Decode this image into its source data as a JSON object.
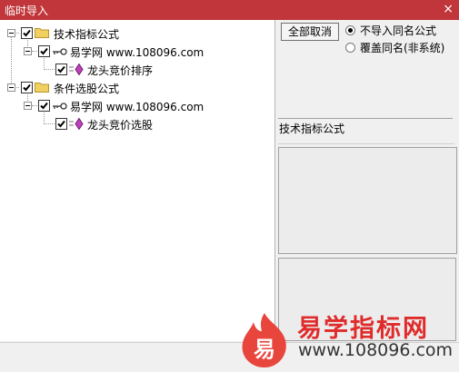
{
  "window": {
    "title": "临时导入",
    "close_glyph": "×"
  },
  "tree": {
    "nodes": [
      {
        "label": "技术指标公式",
        "checked": true
      },
      {
        "label": "易学网 www.108096.com",
        "checked": true
      },
      {
        "label": "龙头竞价排序",
        "checked": true
      },
      {
        "label": "条件选股公式",
        "checked": true
      },
      {
        "label": "易学网 www.108096.com",
        "checked": true
      },
      {
        "label": "龙头竞价选股",
        "checked": true
      }
    ]
  },
  "controls": {
    "cancel_all_label": "全部取消",
    "radio_options": [
      {
        "label": "不导入同名公式",
        "selected": true
      },
      {
        "label": "覆盖同名(非系统)",
        "selected": false
      }
    ]
  },
  "info": {
    "type_label": "技术指标公式"
  },
  "watermark": {
    "logo_char": "易",
    "brand": "易学指标网",
    "url": "www.108096.com",
    "brand_color": "#e02b2b",
    "logo_color": "#e8453c"
  },
  "colors": {
    "titlebar": "#c0363a",
    "folder": "#f0d060",
    "formula_icon": "#c040c0"
  }
}
